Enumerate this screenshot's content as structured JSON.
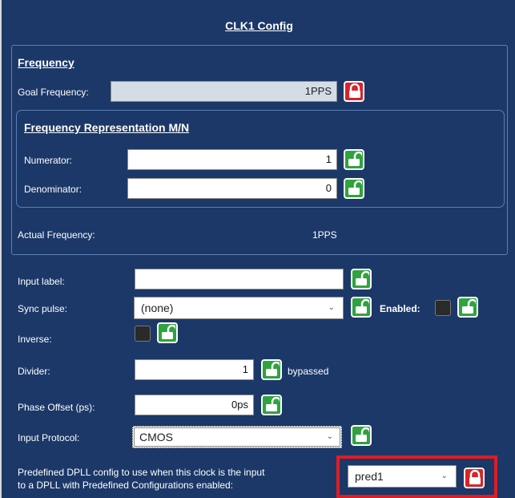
{
  "title": "CLK1 Config",
  "frequency": {
    "heading": "Frequency",
    "goal_label": "Goal Frequency:",
    "goal_value": "1PPS",
    "mn": {
      "heading": "Frequency Representation M/N",
      "numerator_label": "Numerator:",
      "numerator_value": "1",
      "denominator_label": "Denominator:",
      "denominator_value": "0"
    },
    "actual_label": "Actual Frequency:",
    "actual_value": "1PPS"
  },
  "input": {
    "label_label": "Input label:",
    "label_value": "",
    "sync_label": "Sync pulse:",
    "sync_value": "(none)",
    "enabled_label": "Enabled:",
    "inverse_label": "Inverse:",
    "divider_label": "Divider:",
    "divider_value": "1",
    "bypassed_text": "bypassed",
    "phase_label": "Phase Offset (ps):",
    "phase_value": "0ps",
    "protocol_label": "Input Protocol:",
    "protocol_value": "CMOS",
    "predef_label_line1": "Predefined DPLL config to use when this clock is the input",
    "predef_label_line2": "to a DPLL with Predefined Configurations enabled:",
    "predef_value": "pred1"
  },
  "icons": {
    "lock_locked": "lock-closed-icon",
    "lock_unlocked": "lock-open-icon",
    "dropdown": "chevron-down-icon"
  },
  "colors": {
    "background": "#1b3868",
    "lock_green": "#2fa33d",
    "lock_red": "#d8232a",
    "highlight": "#e01c22"
  }
}
